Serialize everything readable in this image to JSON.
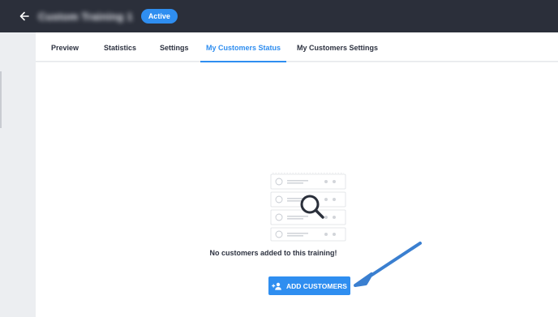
{
  "header": {
    "title": "Custom Training 1",
    "status": "Active",
    "back_icon": "arrow-left-icon"
  },
  "tabs": [
    {
      "label": "Preview",
      "active": false
    },
    {
      "label": "Statistics",
      "active": false
    },
    {
      "label": "Settings",
      "active": false
    },
    {
      "label": "My Customers Status",
      "active": true
    },
    {
      "label": "My Customers Settings",
      "active": false
    }
  ],
  "empty_state": {
    "message": "No customers added to this training!",
    "illustration_icon": "magnifier-list-icon"
  },
  "add_button": {
    "label": "ADD CUSTOMERS",
    "icon": "add-user-icon"
  },
  "colors": {
    "accent": "#2f8ef0",
    "header_bg": "#2b2f3a",
    "annotation_arrow": "#3a7fd0"
  }
}
